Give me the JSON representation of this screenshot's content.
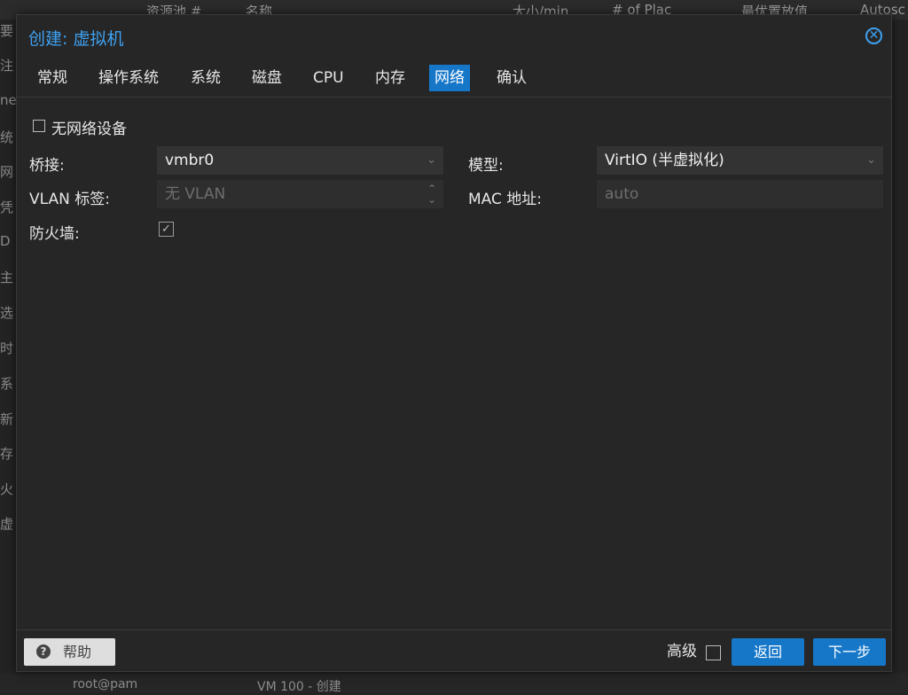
{
  "background": {
    "columns": [
      "资源池 #",
      "名称",
      "大小/min",
      "# of Plac",
      "最优置放值",
      "Autosc"
    ],
    "sidebar_chars": [
      "要",
      "注",
      "nei",
      "统",
      "网",
      "凭",
      "D",
      "主",
      "选",
      "时",
      "系",
      "新",
      "存",
      "火",
      "虚"
    ],
    "bottom": [
      "root@pam",
      "VM 100 - 创建"
    ]
  },
  "dialog": {
    "title": "创建: 虚拟机",
    "close_icon": "close-circle-icon",
    "tabs": [
      "常规",
      "操作系统",
      "系统",
      "磁盘",
      "CPU",
      "内存",
      "网络",
      "确认"
    ],
    "active_tab": "网络"
  },
  "form": {
    "no_network_label": "无网络设备",
    "bridge_label": "桥接:",
    "bridge_value": "vmbr0",
    "model_label": "模型:",
    "model_value": "VirtIO (半虚拟化)",
    "vlan_label": "VLAN 标签:",
    "vlan_placeholder": "无 VLAN",
    "mac_label": "MAC 地址:",
    "mac_placeholder": "auto",
    "firewall_label": "防火墙:",
    "firewall_checked": true
  },
  "footer": {
    "help_label": "帮助",
    "advanced_label": "高级",
    "back_label": "返回",
    "next_label": "下一步"
  },
  "colors": {
    "accent": "#1677c9",
    "title": "#3ea0f0",
    "dialog_bg": "#262626"
  }
}
